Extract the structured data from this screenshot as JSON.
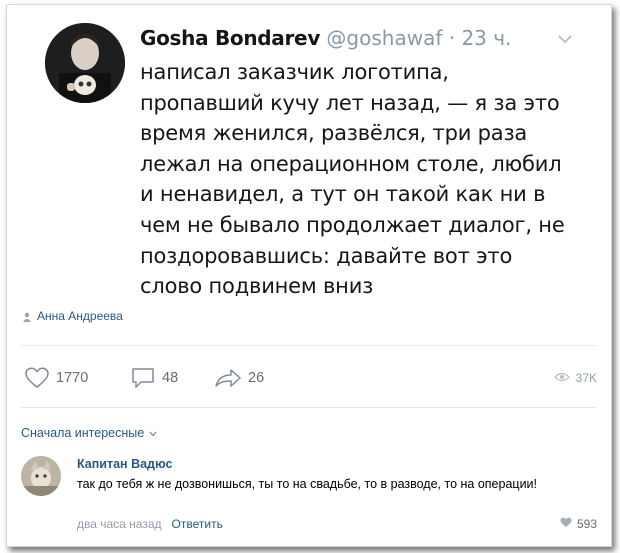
{
  "tweet": {
    "author_name": "Gosha Bondarev",
    "handle": "@goshawaf",
    "separator": "·",
    "time": "23 ч.",
    "text": "написал заказчик логотипа,\nпропавший кучу лет назад, — я за это\nвремя женился, развёлся, три раза\nлежал на операционном столе, любил\nи ненавидел, а тут он такой как ни в\nчем не бывало продолжает диалог, не\nпоздоровавшись: давайте вот это\nслово подвинем вниз"
  },
  "post": {
    "author": "Анна Андреева"
  },
  "actions": {
    "likes": "1770",
    "comments": "48",
    "shares": "26",
    "views": "37K"
  },
  "comments": {
    "sort_label": "Сначала интересные",
    "items": [
      {
        "author": "Капитан Вадюс",
        "text": "так до тебя ж не дозвонишься, ты то на свадьбе, то в разводе, то на операции!",
        "time": "два часа назад",
        "reply_label": "Ответить",
        "likes": "593"
      }
    ]
  },
  "colors": {
    "link": "#2a5885",
    "muted": "#939cab",
    "twitter_gray": "#8899a6"
  }
}
